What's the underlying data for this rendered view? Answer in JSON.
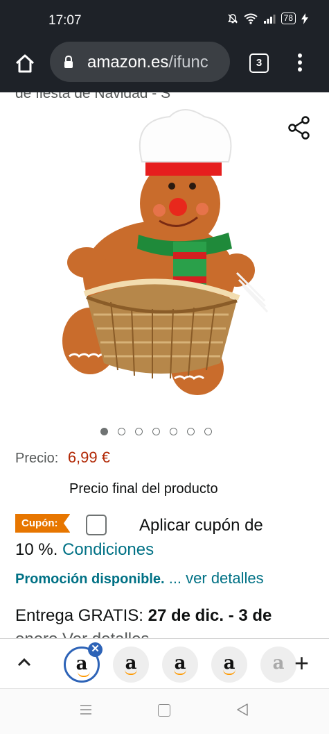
{
  "status": {
    "time": "17:07",
    "battery": "78"
  },
  "browser": {
    "url_host": "amazon.es",
    "url_rest": "/ifunc",
    "tab_count": "3"
  },
  "product": {
    "title_cut": "de fiesta de Navidad - S",
    "carousel_count": 7,
    "carousel_active": 0,
    "price_label": "Precio:",
    "price": "6,99 €",
    "final_price_note": "Precio final del producto",
    "coupon_badge": "Cupón:",
    "coupon_text": "Aplicar cupón de",
    "coupon_line2_prefix": "10 %.",
    "coupon_conditions": "Condiciones",
    "promo_label": "Promoción disponible.",
    "promo_link": "... ver detalles",
    "delivery_prefix": "Entrega GRATIS:",
    "delivery_dates": "27 de dic. - 3 de",
    "delivery_cut": "enero  Ver detalles"
  },
  "tabstrip": {
    "tab_letter": "a"
  },
  "colors": {
    "price": "#b12704",
    "link": "#007185",
    "coupon_badge": "#e77600",
    "active_tab": "#2d63b7"
  }
}
